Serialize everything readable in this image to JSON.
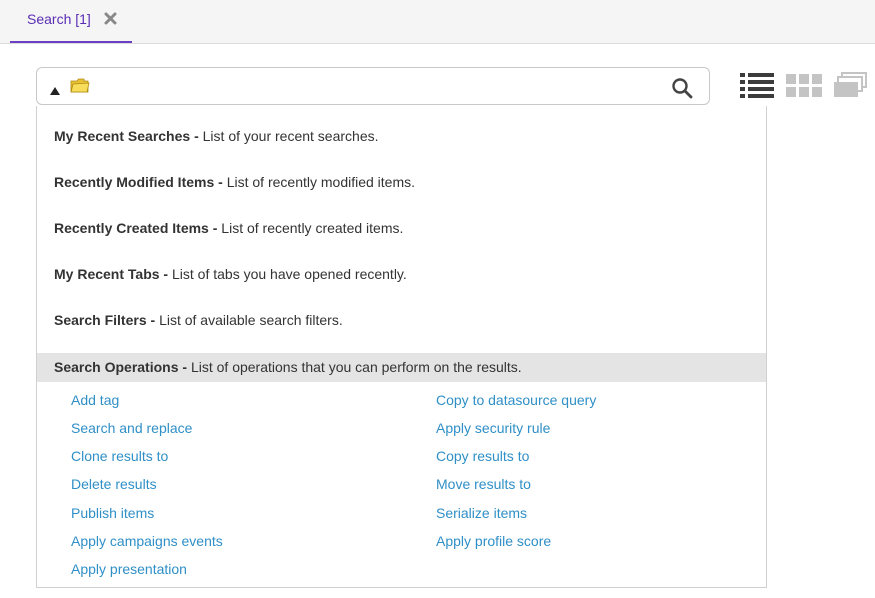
{
  "tab": {
    "label": "Search [1]"
  },
  "search": {
    "value": "",
    "placeholder": ""
  },
  "icons": {
    "close": "close-icon",
    "caret": "caret-up-icon",
    "folder": "folder-icon",
    "search": "search-icon",
    "list_view": "list-view-icon",
    "grid_view": "grid-view-icon",
    "stack_view": "stack-view-icon"
  },
  "colors": {
    "accent": "#5a2db5",
    "link": "#2f8fc7",
    "header_bg": "#e4e4e4"
  },
  "menu": [
    {
      "title": "My Recent Searches",
      "desc": "List of your recent searches."
    },
    {
      "title": "Recently Modified Items",
      "desc": "List of recently modified items."
    },
    {
      "title": "Recently Created Items",
      "desc": "List of recently created items."
    },
    {
      "title": "My Recent Tabs",
      "desc": "List of tabs you have opened recently."
    },
    {
      "title": "Search Filters",
      "desc": "List of available search filters."
    }
  ],
  "operations": {
    "title": "Search Operations",
    "desc": "List of operations that you can perform on the results.",
    "left": [
      "Add tag",
      "Search and replace",
      "Clone results to",
      "Delete results",
      "Publish items",
      "Apply campaigns events",
      "Apply presentation"
    ],
    "right": [
      "Copy to datasource query",
      "Apply security rule",
      "Copy results to",
      "Move results to",
      "Serialize items",
      "Apply profile score"
    ]
  }
}
